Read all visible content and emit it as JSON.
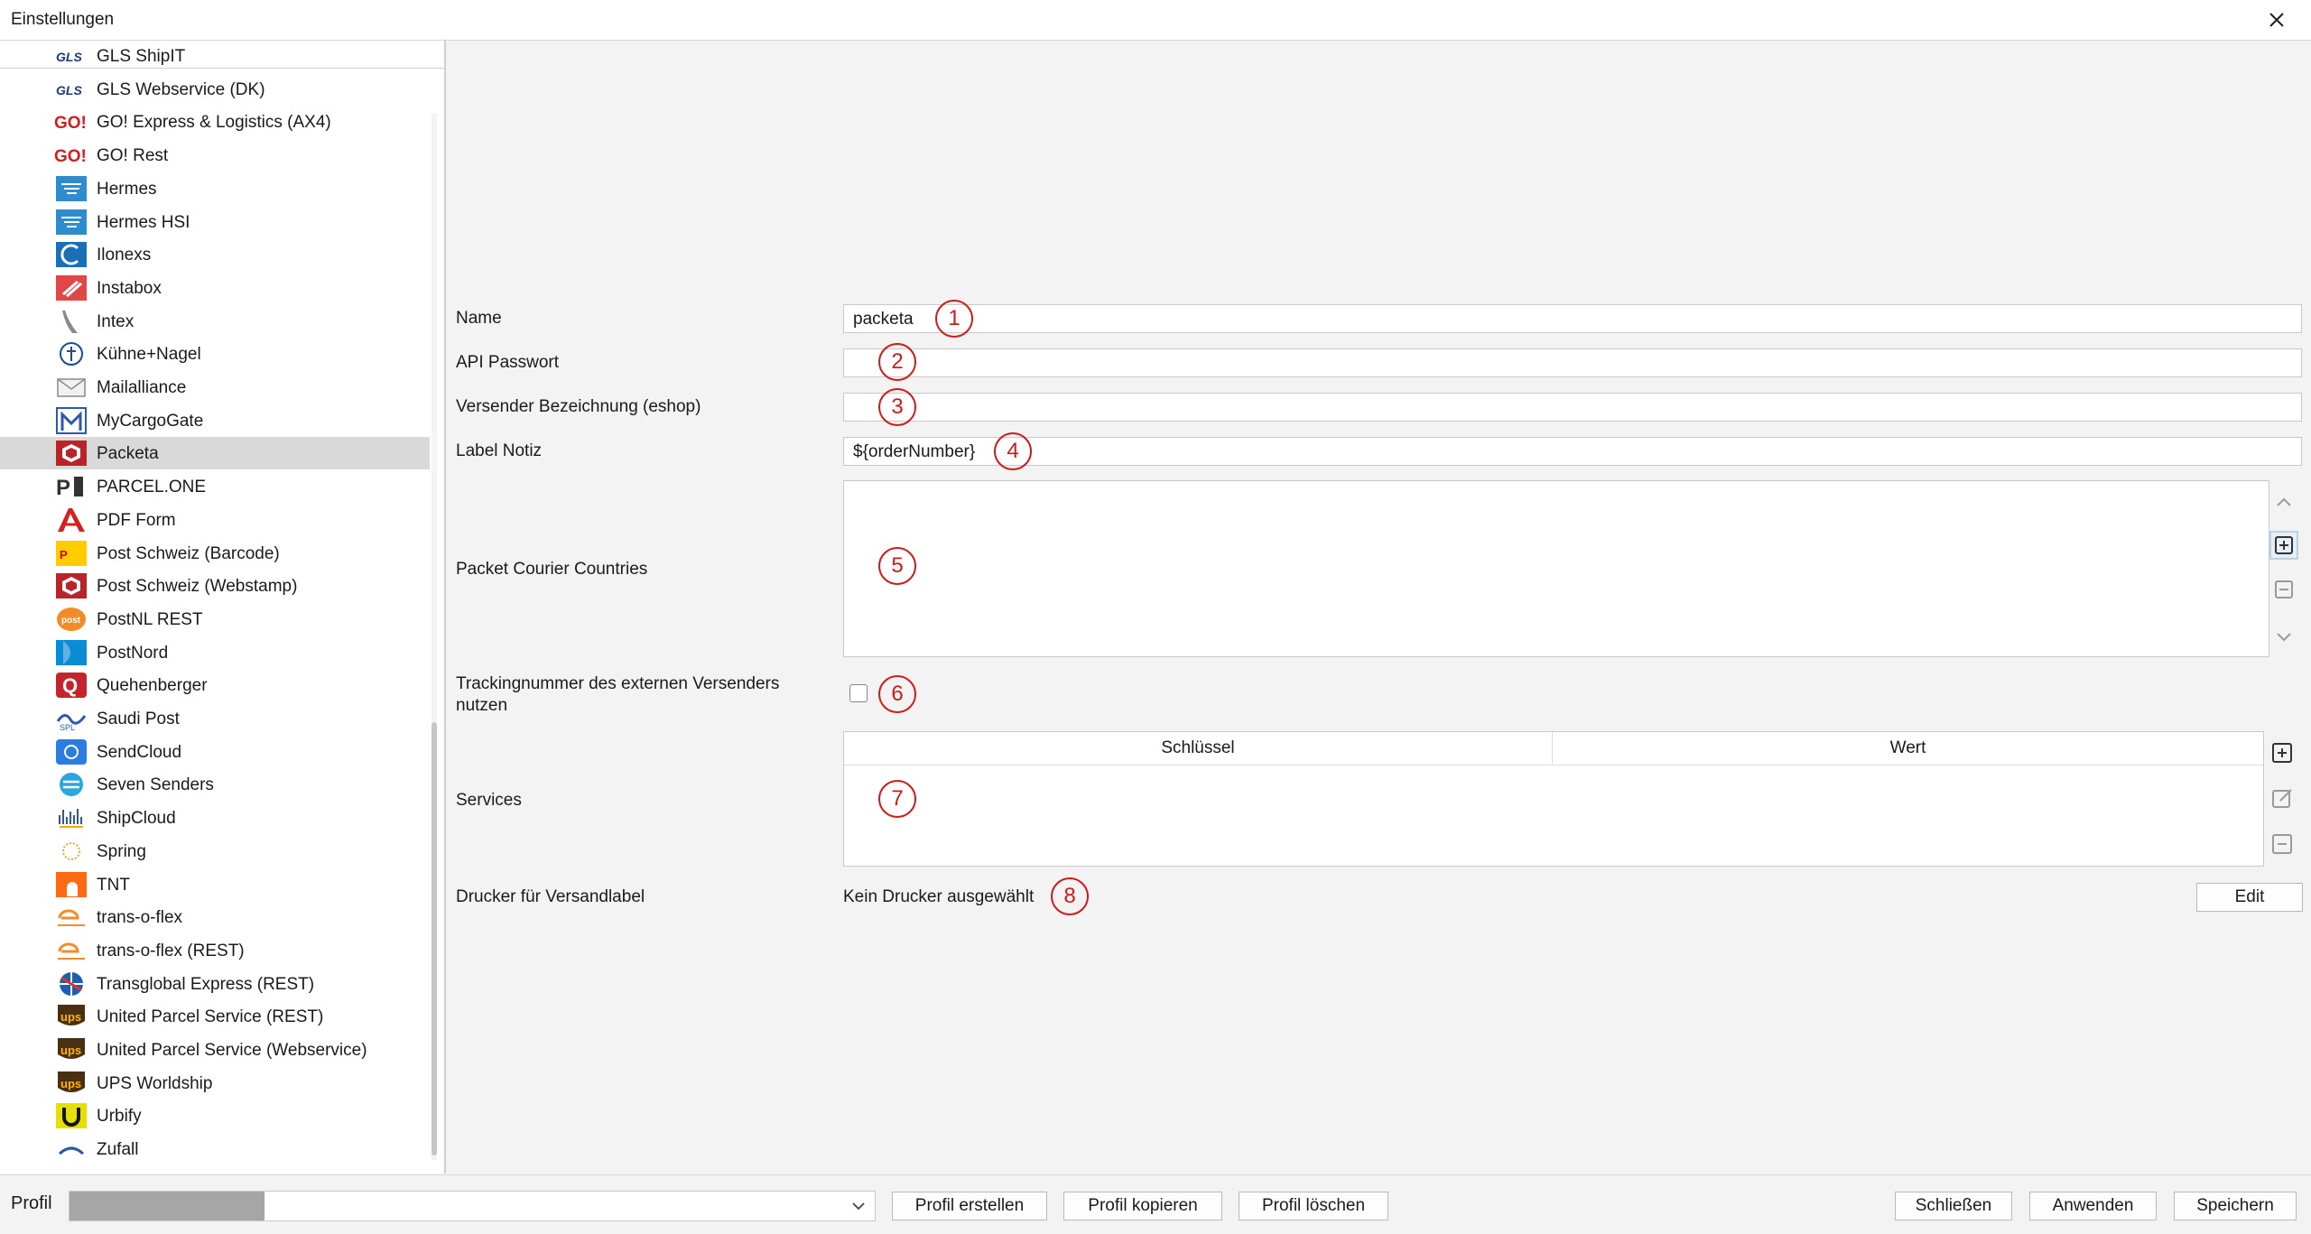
{
  "window": {
    "title": "Einstellungen"
  },
  "tree": {
    "items": [
      {
        "label": "GLS ShipIT",
        "icon": "gls-logo-icon"
      },
      {
        "label": "GLS Webservice (DK)",
        "icon": "gls-logo-icon"
      },
      {
        "label": "GO! Express & Logistics (AX4)",
        "icon": "go-logo-icon"
      },
      {
        "label": "GO! Rest",
        "icon": "go-logo-icon"
      },
      {
        "label": "Hermes",
        "icon": "hermes-logo-icon"
      },
      {
        "label": "Hermes HSI",
        "icon": "hermes-logo-icon"
      },
      {
        "label": "Ilonexs",
        "icon": "ilonexs-logo-icon"
      },
      {
        "label": "Instabox",
        "icon": "instabox-logo-icon"
      },
      {
        "label": "Intex",
        "icon": "intex-logo-icon"
      },
      {
        "label": "Kühne+Nagel",
        "icon": "kuehne-nagel-logo-icon"
      },
      {
        "label": "Mailalliance",
        "icon": "mail-envelope-icon"
      },
      {
        "label": "MyCargoGate",
        "icon": "mycargogate-logo-icon"
      },
      {
        "label": "Packeta",
        "icon": "packeta-logo-icon",
        "selected": true
      },
      {
        "label": "PARCEL.ONE",
        "icon": "parcel-one-logo-icon"
      },
      {
        "label": "PDF Form",
        "icon": "pdf-logo-icon"
      },
      {
        "label": "Post Schweiz (Barcode)",
        "icon": "post-schweiz-logo-icon"
      },
      {
        "label": "Post Schweiz (Webstamp)",
        "icon": "webstamp-logo-icon"
      },
      {
        "label": "PostNL REST",
        "icon": "postnl-logo-icon"
      },
      {
        "label": "PostNord",
        "icon": "postnord-logo-icon"
      },
      {
        "label": "Quehenberger",
        "icon": "quehenberger-logo-icon"
      },
      {
        "label": "Saudi Post",
        "icon": "saudi-post-logo-icon"
      },
      {
        "label": "SendCloud",
        "icon": "sendcloud-logo-icon"
      },
      {
        "label": "Seven Senders",
        "icon": "seven-senders-logo-icon"
      },
      {
        "label": "ShipCloud",
        "icon": "shipcloud-logo-icon"
      },
      {
        "label": "Spring",
        "icon": "spring-logo-icon"
      },
      {
        "label": "TNT",
        "icon": "tnt-logo-icon"
      },
      {
        "label": "trans-o-flex",
        "icon": "trans-o-flex-logo-icon"
      },
      {
        "label": "trans-o-flex (REST)",
        "icon": "trans-o-flex-logo-icon"
      },
      {
        "label": "Transglobal Express (REST)",
        "icon": "transglobal-logo-icon"
      },
      {
        "label": "United Parcel Service (REST)",
        "icon": "ups-logo-icon"
      },
      {
        "label": "United Parcel Service (Webservice)",
        "icon": "ups-logo-icon"
      },
      {
        "label": "UPS Worldship",
        "icon": "ups-logo-icon"
      },
      {
        "label": "Urbify",
        "icon": "urbify-logo-icon"
      },
      {
        "label": "Zufall",
        "icon": "zufall-logo-icon"
      }
    ]
  },
  "form": {
    "name_label": "Name",
    "name_value": "packeta",
    "api_password_label": "API Passwort",
    "api_password_value": "",
    "sender_label": "Versender Bezeichnung (eshop)",
    "sender_value": "",
    "label_note_label": "Label Notiz",
    "label_note_value": "${orderNumber}",
    "countries_label": "Packet Courier Countries",
    "tracking_label_line1": "Trackingnummer des externen Versenders",
    "tracking_label_line2": "nutzen",
    "tracking_checked": false,
    "services_label": "Services",
    "services_columns": [
      "Schlüssel",
      "Wert"
    ],
    "printer_label": "Drucker für Versandlabel",
    "printer_value": "Kein Drucker ausgewählt",
    "edit_button": "Edit"
  },
  "markers": [
    "1",
    "2",
    "3",
    "4",
    "5",
    "6",
    "7",
    "8"
  ],
  "bottom": {
    "profile_label": "Profil",
    "create_profile": "Profil erstellen",
    "copy_profile": "Profil kopieren",
    "delete_profile": "Profil löschen",
    "close": "Schließen",
    "apply": "Anwenden",
    "save": "Speichern"
  },
  "colors": {
    "marker_red": "#d11a1a",
    "selected_row": "#d9d9d9"
  }
}
